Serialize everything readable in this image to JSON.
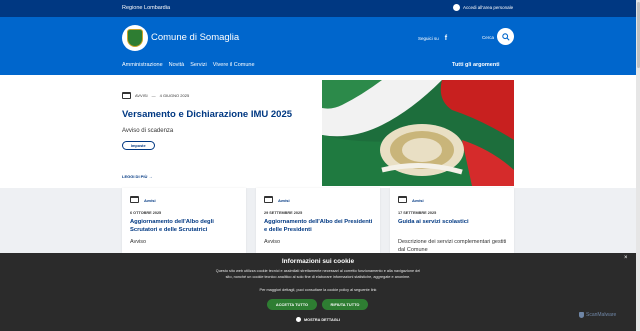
{
  "topbar": {
    "region": "Regione Lombardia",
    "access_label": "Accedi all'area personale"
  },
  "header": {
    "site_title": "Comune di Somaglia",
    "follow_label": "Seguici su",
    "facebook_glyph": "f",
    "search_label": "Cerca",
    "nav": [
      "Amministrazione",
      "Novità",
      "Servizi",
      "Vivere il Comune"
    ],
    "all_topics": "Tutti gli argomenti"
  },
  "hero": {
    "category": "AVVISI",
    "separator": "—",
    "date": "4 GIUGNO 2025",
    "title": "Versamento e Dichiarazione IMU 2025",
    "description": "Avviso di scadenza",
    "tag": "Imposte",
    "read_more": "LEGGI DI PIÙ",
    "read_more_arrow": "→"
  },
  "cards": [
    {
      "category": "Avvisi",
      "date": "6 OTTOBRE 2025",
      "title": "Aggiornamento dell'Albo degli Scrutatori e delle Scrutatrici",
      "description": "Avviso"
    },
    {
      "category": "Avvisi",
      "date": "29 SETTEMBRE 2025",
      "title": "Aggiornamento dell'Albo dei Presidenti e delle Presidenti",
      "description": "Avviso"
    },
    {
      "category": "Avvisi",
      "date": "17 SETTEMBRE 2025",
      "title": "Guida ai servizi scolastici",
      "description": "Descrizione dei servizi complementari gestiti dal Comune"
    }
  ],
  "cookie": {
    "close_glyph": "×",
    "title": "Informazioni sui cookie",
    "text": "Questo sito web utilizza cookie tecnici e assimilati strettamente necessari al corretto funzionamento e alla navigazione del sito, nonché un cookie tecnico analitico al solo fine di elaborare informazioni statistiche, aggregate e anonime.",
    "policy": "Per maggiori dettagli, puoi consultare la cookie policy al seguente link",
    "accept": "ACCETTA TUTTO",
    "reject": "RIFIUTA TUTTO",
    "details": "MOSTRA DETTAGLI"
  },
  "watermark": "ScanMalware",
  "colors": {
    "topbar": "#003882",
    "header": "#0066cc",
    "title_blue": "#003882",
    "button_green": "#2e7d32",
    "banner_bg": "#2b2b2b"
  },
  "icons": {
    "access": "user-circle-icon",
    "facebook": "facebook-icon",
    "search": "search-icon",
    "calendar": "calendar-icon",
    "close": "close-icon",
    "gear": "gear-icon"
  }
}
